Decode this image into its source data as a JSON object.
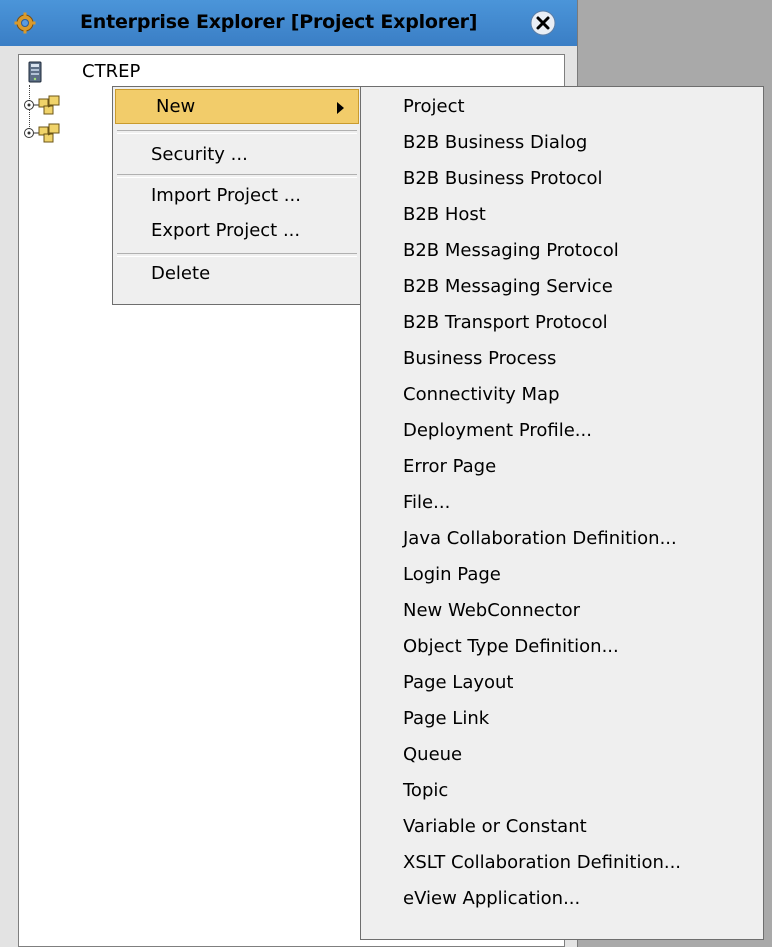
{
  "window": {
    "title": "Enterprise Explorer [Project Explorer]"
  },
  "tree": {
    "root_label": "CTREP"
  },
  "context_menu": {
    "new_label": "New",
    "security_label": "Security ...",
    "import_label": "Import Project ...",
    "export_label": "Export Project ...",
    "delete_label": "Delete"
  },
  "submenu": {
    "items": [
      "Project",
      "B2B Business Dialog",
      "B2B Business Protocol",
      "B2B Host",
      "B2B Messaging Protocol",
      "B2B Messaging Service",
      "B2B Transport Protocol",
      "Business Process",
      "Connectivity Map",
      "Deployment Profile...",
      "Error Page",
      "File...",
      "Java Collaboration Definition...",
      "Login Page",
      "New WebConnector",
      "Object Type Definition...",
      "Page Layout",
      "Page Link",
      "Queue",
      "Topic",
      "Variable or Constant",
      "XSLT Collaboration Definition...",
      "eView Application..."
    ]
  },
  "colors": {
    "titlebar": "#3f86cf",
    "menu_highlight": "#f2cc6a",
    "menu_background": "#efefef",
    "workspace_gray": "#a9a9a9"
  },
  "icons": {
    "title": "gear-icon",
    "close": "close-icon",
    "root": "repository-server-icon",
    "project": "project-icon"
  }
}
